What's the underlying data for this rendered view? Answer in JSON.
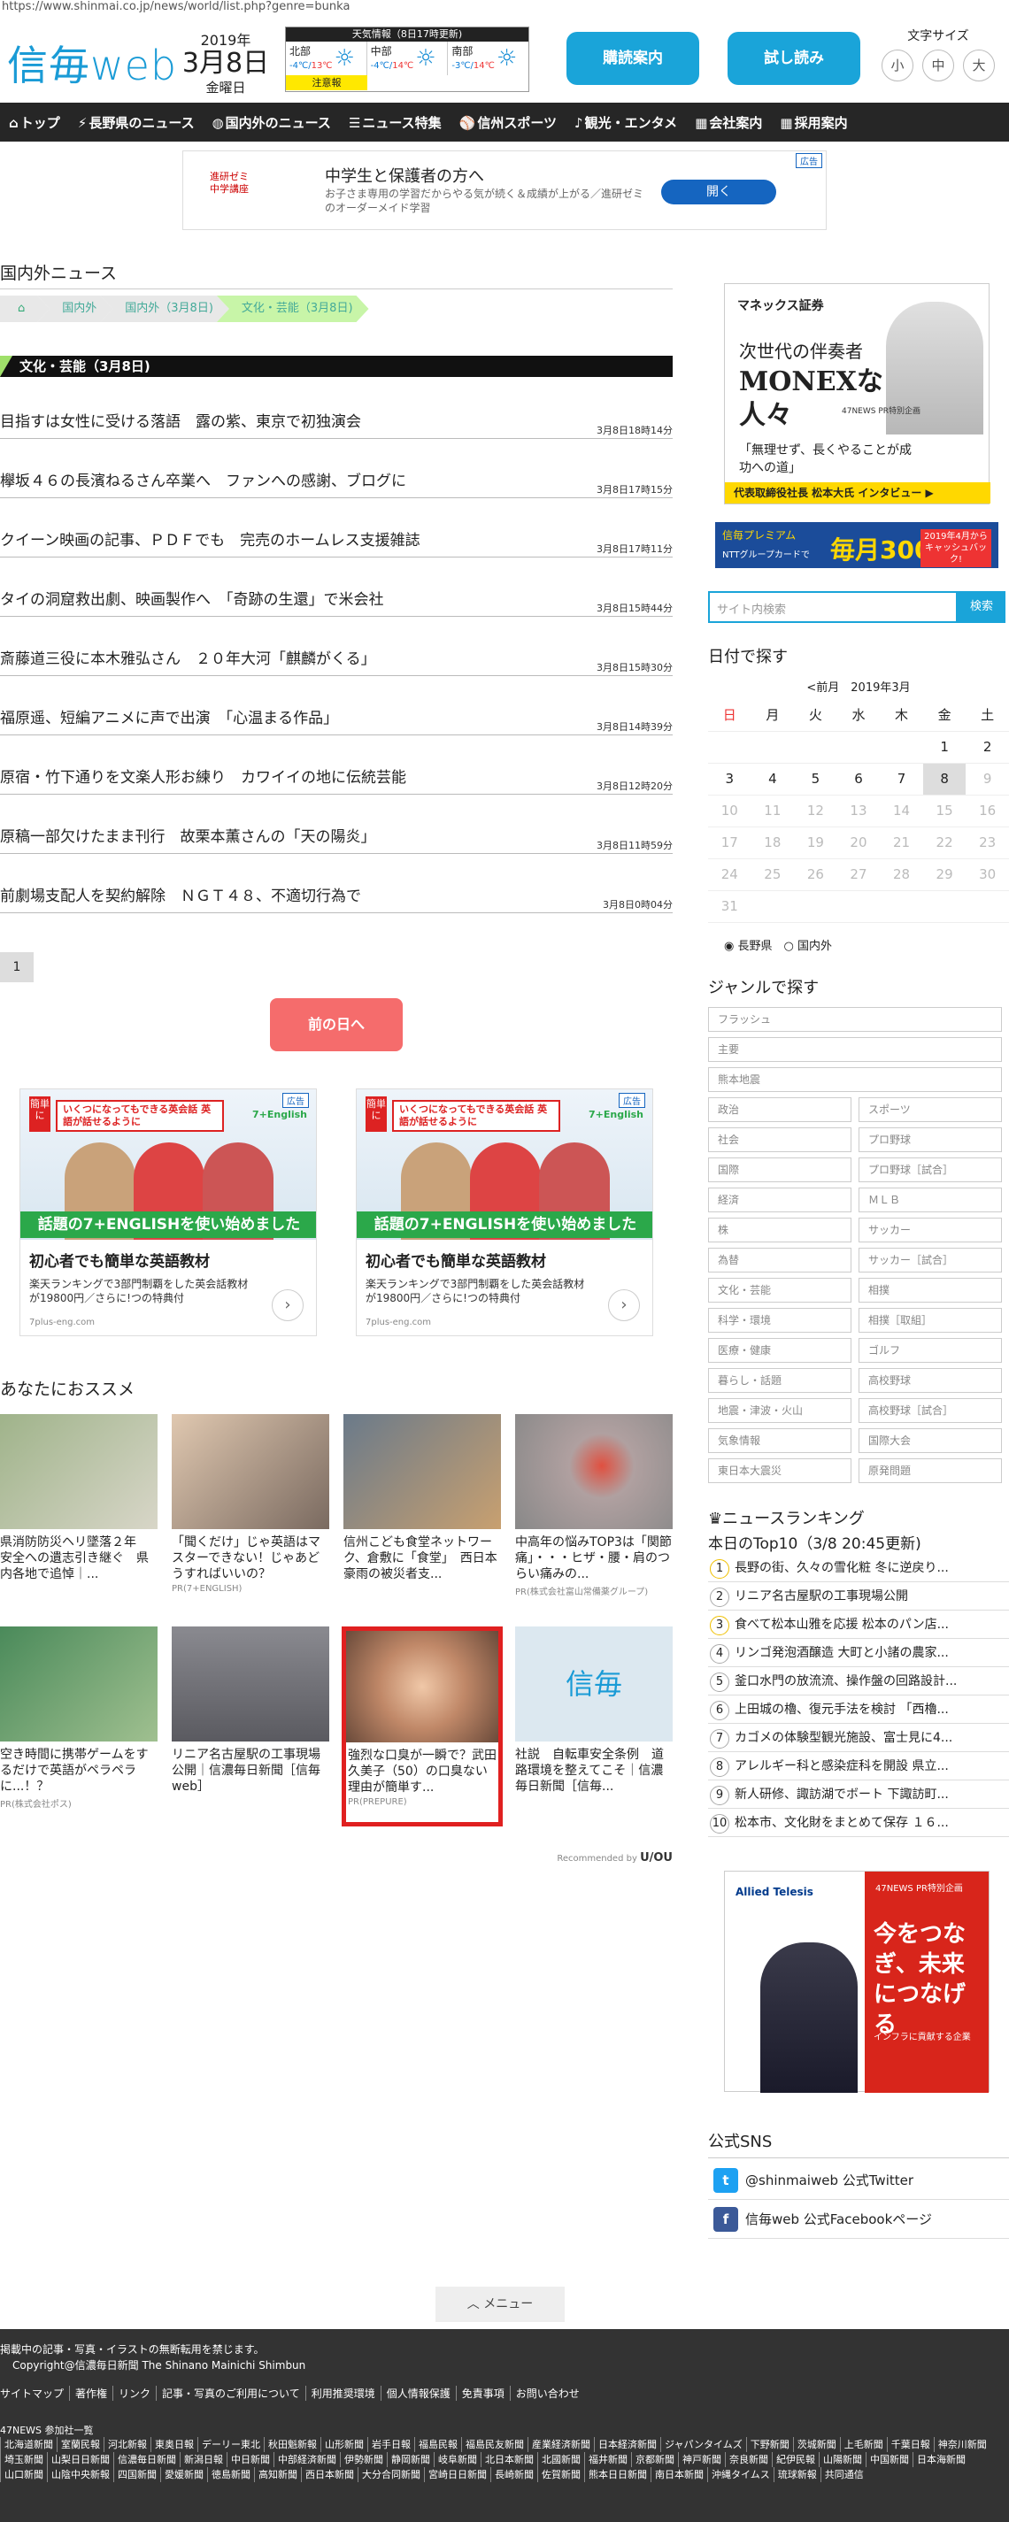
{
  "url": "https://www.shinmai.co.jp/news/world/list.php?genre=bunka",
  "logo": {
    "kanji": "信毎",
    "web": "web"
  },
  "date": {
    "year": "2019年",
    "day": "3月8日",
    "weekday": "金曜日"
  },
  "weather": {
    "title": "天気情報（8日17時更新)",
    "regions": [
      {
        "name": "北部",
        "low": "-4℃",
        "high": "13℃"
      },
      {
        "name": "中部",
        "low": "-4℃",
        "high": "14℃"
      },
      {
        "name": "南部",
        "low": "-3℃",
        "high": "14℃"
      }
    ],
    "warning": "注意報"
  },
  "header_buttons": {
    "subscribe": "購読案内",
    "trial": "試し読み"
  },
  "font_size": {
    "label": "文字サイズ",
    "small": "小",
    "medium": "中",
    "large": "大"
  },
  "nav": [
    {
      "icon": "home-icon",
      "glyph": "⌂",
      "label": "トップ"
    },
    {
      "icon": "bolt-icon",
      "glyph": "⚡",
      "label": "長野県のニュース"
    },
    {
      "icon": "globe-icon",
      "glyph": "◍",
      "label": "国内外のニュース"
    },
    {
      "icon": "document-icon",
      "glyph": "☰",
      "label": "ニュース特集"
    },
    {
      "icon": "baseball-icon",
      "glyph": "⚾",
      "label": "信州スポーツ"
    },
    {
      "icon": "guitar-icon",
      "glyph": "♪",
      "label": "観光・エンタメ"
    },
    {
      "icon": "building-icon",
      "glyph": "▦",
      "label": "会社案内"
    },
    {
      "icon": "building-icon",
      "glyph": "▦",
      "label": "採用案内"
    }
  ],
  "top_ad": {
    "logo": "進研ゼミ\n中学講座",
    "title": "中学生と保護者の方へ",
    "desc": "お子さま専用の学習だからやる気が続く＆成績が上がる／進研ゼミのオーダーメイド学習",
    "button": "開く",
    "tag": "広告"
  },
  "main": {
    "section_title": "国内外ニュース",
    "breadcrumbs": [
      "国内外",
      "国内外（3月8日)",
      "文化・芸能（3月8日)"
    ],
    "category": "文化・芸能（3月8日)",
    "news": [
      {
        "title": "目指すは女性に受ける落語　露の紫、東京で初独演会",
        "time": "3月8日18時14分"
      },
      {
        "title": "欅坂４６の長濱ねるさん卒業へ　ファンへの感謝、ブログに",
        "time": "3月8日17時15分"
      },
      {
        "title": "クイーン映画の記事、ＰＤＦでも　完売のホームレス支援雑誌",
        "time": "3月8日17時11分"
      },
      {
        "title": "タイの洞窟救出劇、映画製作へ　「奇跡の生還」で米会社",
        "time": "3月8日15時44分"
      },
      {
        "title": "斎藤道三役に本木雅弘さん　２０年大河「麒麟がくる」",
        "time": "3月8日15時30分"
      },
      {
        "title": "福原遥、短編アニメに声で出演　「心温まる作品」",
        "time": "3月8日14時39分"
      },
      {
        "title": "原宿・竹下通りを文楽人形お練り　カワイイの地に伝統芸能",
        "time": "3月8日12時20分"
      },
      {
        "title": "原稿一部欠けたまま刊行　故栗本薫さんの「天の陽炎」",
        "time": "3月8日11時59分"
      },
      {
        "title": "前劇場支配人を契約解除　ＮＧＴ４８、不適切行為で",
        "time": "3月8日0時04分"
      }
    ],
    "page": "1",
    "prev_day": "前の日へ"
  },
  "english_ad": {
    "badge": "簡単に",
    "tagline": "いくつになってもできる英会話 英語が話せるように",
    "tag": "広告",
    "brand": "7+English",
    "banner": "話題の7+ENGLISHを使い始めました",
    "headline": "初心者でも簡単な英語教材",
    "desc": "楽天ランキングで3部門制覇をした英会話教材が19800円／さらに!つの特典付",
    "domain": "7plus-eng.com"
  },
  "recommend": {
    "title": "あなたにおススメ",
    "items": [
      {
        "title": "県消防防災ヘリ墜落２年　安全への遺志引き継ぐ　県内各地で追悼｜...",
        "pr": ""
      },
      {
        "title": "「聞くだけ」じゃ英語はマスターできない！じゃあどうすればいいの？",
        "pr": "PR(7+ENGLISH)"
      },
      {
        "title": "信州こども食堂ネットワーク、倉敷に「食堂」　西日本豪雨の被災者支...",
        "pr": ""
      },
      {
        "title": "中高年の悩みTOP3は「関節痛」・・・ヒザ・腰・肩のつらい痛みの...",
        "pr": "PR(株式会社富山常備薬グループ)"
      },
      {
        "title": "空き時間に携帯ゲームをするだけで英語がペラペラに...！？",
        "pr": "PR(株式会社ポス)"
      },
      {
        "title": "リニア名古屋駅の工事現場公開｜信濃毎日新聞［信毎web］",
        "pr": ""
      },
      {
        "title": "強烈な口臭が一瞬で？武田久美子（50）の口臭ない理由が簡単す...",
        "pr": "PR(PREPURE)"
      },
      {
        "title": "社説　自転車安全条例　道路環境を整えてこそ｜信濃毎日新聞［信毎...",
        "pr": ""
      }
    ],
    "by": "Recommended by",
    "by_brand": "U/OU"
  },
  "side": {
    "monex": {
      "logo": "マネックス証券",
      "line1": "次世代の伴奏者",
      "line2": "MONEXな人々",
      "np": "47NEWS PR特別企画",
      "line3": "「無理せず、長くやることが成功への道」",
      "bottom": "代表取締役社長 松本大氏 インタビュー ▶"
    },
    "premium": {
      "a": "信毎プレミアム",
      "b": "NTTグループカードで",
      "c": "毎月300円",
      "d": "2019年4月からキャッシュバック!"
    },
    "search_placeholder": "サイト内検索",
    "search_button": "検索",
    "calendar": {
      "title": "日付で探す",
      "prev": "<前月",
      "month": "2019年3月",
      "weekdays": [
        "日",
        "月",
        "火",
        "水",
        "木",
        "金",
        "土"
      ],
      "rows": [
        [
          "",
          "",
          "",
          "",
          "",
          "1",
          "2"
        ],
        [
          "3",
          "4",
          "5",
          "6",
          "7",
          "8",
          "9"
        ],
        [
          "10",
          "11",
          "12",
          "13",
          "14",
          "15",
          "16"
        ],
        [
          "17",
          "18",
          "19",
          "20",
          "21",
          "22",
          "23"
        ],
        [
          "24",
          "25",
          "26",
          "27",
          "28",
          "29",
          "30"
        ],
        [
          "31",
          "",
          "",
          "",
          "",
          "",
          ""
        ]
      ],
      "opt1": "長野県",
      "opt2": "国内外"
    },
    "genre": {
      "title": "ジャンルで探す",
      "full": [
        "フラッシュ",
        "主要",
        "熊本地震"
      ],
      "pairs": [
        [
          "政治",
          "スポーツ"
        ],
        [
          "社会",
          "プロ野球"
        ],
        [
          "国際",
          "プロ野球［試合］"
        ],
        [
          "経済",
          "ＭＬＢ"
        ],
        [
          "株",
          "サッカー"
        ],
        [
          "為替",
          "サッカー［試合］"
        ],
        [
          "文化・芸能",
          "相撲"
        ],
        [
          "科学・環境",
          "相撲［取組］"
        ],
        [
          "医療・健康",
          "ゴルフ"
        ],
        [
          "暮らし・話題",
          "高校野球"
        ],
        [
          "地震・津波・火山",
          "高校野球［試合］"
        ],
        [
          "気象情報",
          "国際大会"
        ],
        [
          "東日本大震災",
          "原発問題"
        ]
      ]
    },
    "ranking": {
      "title": "ニュースランキング",
      "subtitle": "本日のTop10（3/8 20:45更新)",
      "items": [
        "長野の街、久々の雪化粧 冬に逆戻り...",
        "リニア名古屋駅の工事現場公開",
        "食べて松本山雅を応援 松本のパン店...",
        "リンゴ発泡酒醸造 大町と小諸の農家...",
        "釜口水門の放流流、操作盤の回路設計...",
        "上田城の櫓、復元手法を検討 「西櫓...",
        "カゴメの体験型観光施設、富士見に4...",
        "アレルギー科と感染症科を開設 県立...",
        "新人研修、諏訪湖でボート 下諏訪町...",
        "松本市、文化財をまとめて保存 １６..."
      ]
    },
    "allied": {
      "np": "47NEWS PR特別企画",
      "logo": "Allied Telesis",
      "headline": "今をつなぎ、未来につなげる",
      "sub": "インフラに貢献する企業"
    },
    "sns": {
      "title": "公式SNS",
      "twitter": "@shinmaiweb 公式Twitter",
      "facebook": "信毎web 公式Facebookページ"
    }
  },
  "menu_button": "メニュー",
  "footer": {
    "notice": "掲載中の記事・写真・イラストの無断転用を禁じます。",
    "copyright": "Copyright@信濃毎日新聞 The Shinano Mainichi Shimbun",
    "links": [
      "サイトマップ",
      "著作権",
      "リンク",
      "記事・写真のご利用について",
      "利用推奨環境",
      "個人情報保護",
      "免責事項",
      "お問い合わせ"
    ],
    "partner_title": "47NEWS 参加社一覧",
    "partners": [
      "北海道新聞",
      "室蘭民報",
      "河北新報",
      "東奥日報",
      "デーリー東北",
      "秋田魁新報",
      "山形新聞",
      "岩手日報",
      "福島民報",
      "福島民友新聞",
      "産業経済新聞",
      "日本経済新聞",
      "ジャパンタイムズ",
      "下野新聞",
      "茨城新聞",
      "上毛新聞",
      "千葉日報",
      "神奈川新聞",
      "埼玉新聞",
      "山梨日日新聞",
      "信濃毎日新聞",
      "新潟日報",
      "中日新聞",
      "中部経済新聞",
      "伊勢新聞",
      "静岡新聞",
      "岐阜新聞",
      "北日本新聞",
      "北國新聞",
      "福井新聞",
      "京都新聞",
      "神戸新聞",
      "奈良新聞",
      "紀伊民報",
      "山陽新聞",
      "中国新聞",
      "日本海新聞",
      "山口新聞",
      "山陰中央新報",
      "四国新聞",
      "愛媛新聞",
      "徳島新聞",
      "高知新聞",
      "西日本新聞",
      "大分合同新聞",
      "宮崎日日新聞",
      "長崎新聞",
      "佐賀新聞",
      "熊本日日新聞",
      "南日本新聞",
      "沖縄タイムス",
      "琉球新報",
      "共同通信"
    ]
  }
}
